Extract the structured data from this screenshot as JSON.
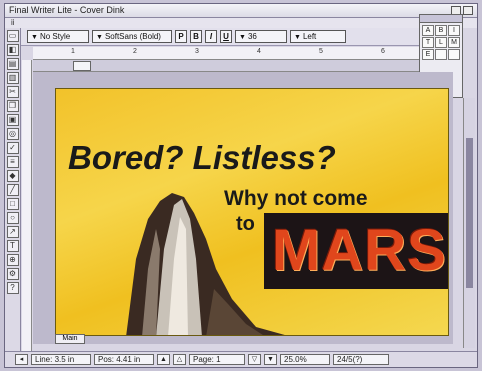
{
  "window": {
    "title": "Final Writer Lite - Cover Dink",
    "menu_label": "ii"
  },
  "toolbar": {
    "style_select": "No Style",
    "font_select": "SoftSans (Bold)",
    "plain_button": "P",
    "bold_button": "B",
    "italic_button": "I",
    "underline_button": "U",
    "size_select": "36",
    "align_select": "Left"
  },
  "ruler": {
    "numbers": [
      "1",
      "2",
      "3",
      "4",
      "5",
      "6"
    ]
  },
  "palette": {
    "tools": [
      "A",
      "B",
      "I",
      "T",
      "L",
      "M",
      "E",
      "",
      ""
    ]
  },
  "document": {
    "headline": "Bored? Listless?",
    "subline": "Why not come",
    "subline2": "to",
    "mars": "MARS",
    "tab_label": "Main"
  },
  "statusbar": {
    "line": "Line: 3.5 in",
    "pos": "Pos: 4.41 in",
    "page": "Page: 1",
    "zoom": "25.0%",
    "extra": "24/5(?)"
  },
  "colors": {
    "page_yellow": "#f2c22a",
    "mars_red": "#e0461c",
    "mars_bg": "#1c1416"
  }
}
